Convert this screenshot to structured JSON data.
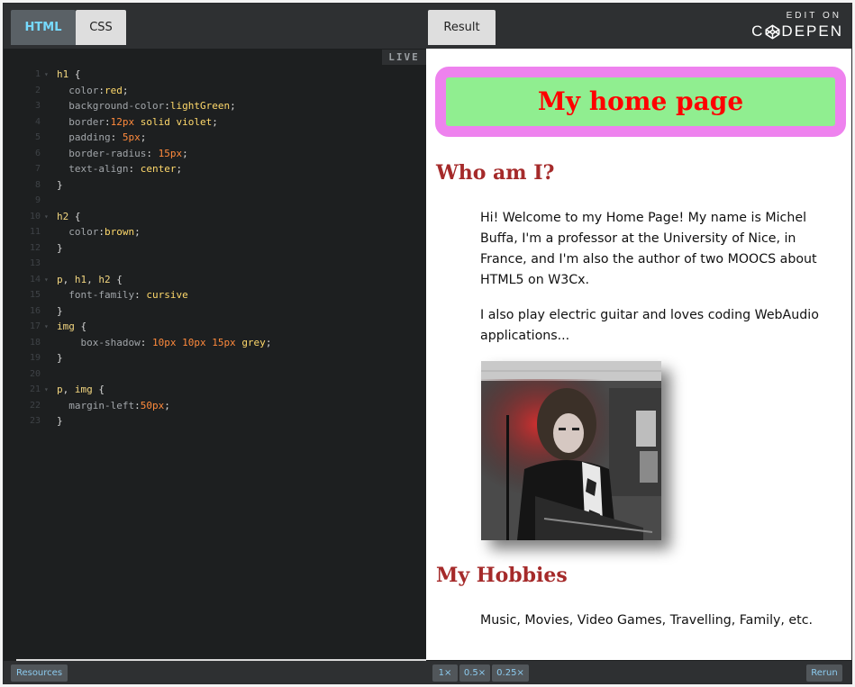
{
  "tabs": {
    "html": "HTML",
    "css": "CSS",
    "result": "Result"
  },
  "codepen": {
    "edit_on": "EDIT ON",
    "brand_left": "C",
    "brand_right": "DEPEN"
  },
  "live_badge": "LIVE",
  "code": [
    {
      "n": "1",
      "f": "▾",
      "t": [
        [
          "sel",
          "h1"
        ],
        [
          "punc",
          " {"
        ]
      ]
    },
    {
      "n": "2",
      "f": "",
      "t": [
        [
          "prop",
          "  color"
        ],
        [
          "punc",
          ":"
        ],
        [
          "val",
          "red"
        ],
        [
          "punc",
          ";"
        ]
      ]
    },
    {
      "n": "3",
      "f": "",
      "t": [
        [
          "prop",
          "  background-color"
        ],
        [
          "punc",
          ":"
        ],
        [
          "val",
          "lightGreen"
        ],
        [
          "punc",
          ";"
        ]
      ]
    },
    {
      "n": "4",
      "f": "",
      "t": [
        [
          "prop",
          "  border"
        ],
        [
          "punc",
          ":"
        ],
        [
          "num",
          "12px"
        ],
        [
          "punc",
          " "
        ],
        [
          "val",
          "solid violet"
        ],
        [
          "punc",
          ";"
        ]
      ]
    },
    {
      "n": "5",
      "f": "",
      "t": [
        [
          "prop",
          "  padding"
        ],
        [
          "punc",
          ": "
        ],
        [
          "num",
          "5px"
        ],
        [
          "punc",
          ";"
        ]
      ]
    },
    {
      "n": "6",
      "f": "",
      "t": [
        [
          "prop",
          "  border-radius"
        ],
        [
          "punc",
          ": "
        ],
        [
          "num",
          "15px"
        ],
        [
          "punc",
          ";"
        ]
      ]
    },
    {
      "n": "7",
      "f": "",
      "t": [
        [
          "prop",
          "  text-align"
        ],
        [
          "punc",
          ": "
        ],
        [
          "val",
          "center"
        ],
        [
          "punc",
          ";"
        ]
      ]
    },
    {
      "n": "8",
      "f": "",
      "t": [
        [
          "punc",
          "}"
        ]
      ]
    },
    {
      "n": "9",
      "f": "",
      "t": []
    },
    {
      "n": "10",
      "f": "▾",
      "t": [
        [
          "sel",
          "h2"
        ],
        [
          "punc",
          " {"
        ]
      ]
    },
    {
      "n": "11",
      "f": "",
      "t": [
        [
          "prop",
          "  color"
        ],
        [
          "punc",
          ":"
        ],
        [
          "val",
          "brown"
        ],
        [
          "punc",
          ";"
        ]
      ]
    },
    {
      "n": "12",
      "f": "",
      "t": [
        [
          "punc",
          "}"
        ]
      ]
    },
    {
      "n": "13",
      "f": "",
      "t": []
    },
    {
      "n": "14",
      "f": "▾",
      "t": [
        [
          "sel",
          "p"
        ],
        [
          "punc",
          ", "
        ],
        [
          "sel",
          "h1"
        ],
        [
          "punc",
          ", "
        ],
        [
          "sel",
          "h2"
        ],
        [
          "punc",
          " {"
        ]
      ]
    },
    {
      "n": "15",
      "f": "",
      "t": [
        [
          "prop",
          "  font-family"
        ],
        [
          "punc",
          ": "
        ],
        [
          "val",
          "cursive"
        ]
      ]
    },
    {
      "n": "16",
      "f": "",
      "t": [
        [
          "punc",
          "}"
        ]
      ]
    },
    {
      "n": "17",
      "f": "▾",
      "t": [
        [
          "sel",
          "img"
        ],
        [
          "punc",
          " {"
        ]
      ]
    },
    {
      "n": "18",
      "f": "",
      "t": [
        [
          "prop",
          "    box-shadow"
        ],
        [
          "punc",
          ": "
        ],
        [
          "num",
          "10px 10px 15px"
        ],
        [
          "punc",
          " "
        ],
        [
          "val",
          "grey"
        ],
        [
          "punc",
          ";"
        ]
      ]
    },
    {
      "n": "19",
      "f": "",
      "t": [
        [
          "punc",
          "}"
        ]
      ]
    },
    {
      "n": "20",
      "f": "",
      "t": []
    },
    {
      "n": "21",
      "f": "▾",
      "t": [
        [
          "sel",
          "p"
        ],
        [
          "punc",
          ", "
        ],
        [
          "sel",
          "img"
        ],
        [
          "punc",
          " {"
        ]
      ]
    },
    {
      "n": "22",
      "f": "",
      "t": [
        [
          "prop",
          "  margin-left"
        ],
        [
          "punc",
          ":"
        ],
        [
          "num",
          "50px"
        ],
        [
          "punc",
          ";"
        ]
      ]
    },
    {
      "n": "23",
      "f": "",
      "t": [
        [
          "punc",
          "}"
        ]
      ]
    }
  ],
  "result": {
    "h1": "My home page",
    "h2_who": "Who am I?",
    "p_intro": "Hi! Welcome to my Home Page! My name is Michel Buffa, I'm a professor at the University of Nice, in France, and I'm also the author of two MOOCS about HTML5 on W3Cx.",
    "p_guitar": "I also play electric guitar and loves coding WebAudio applications...",
    "h2_hobbies": "My Hobbies",
    "p_hobbies": "Music, Movies, Video Games, Travelling, Family, etc."
  },
  "bottom": {
    "resources": "Resources",
    "zoom_1x": "1×",
    "zoom_05x": "0.5×",
    "zoom_025x": "0.25×",
    "rerun": "Rerun"
  },
  "colors": {
    "selector": "#f4d780",
    "property": "#a2a6aa",
    "value": "#ffd96b",
    "number": "#ff8a3c",
    "active_tab_text": "#76daff"
  }
}
